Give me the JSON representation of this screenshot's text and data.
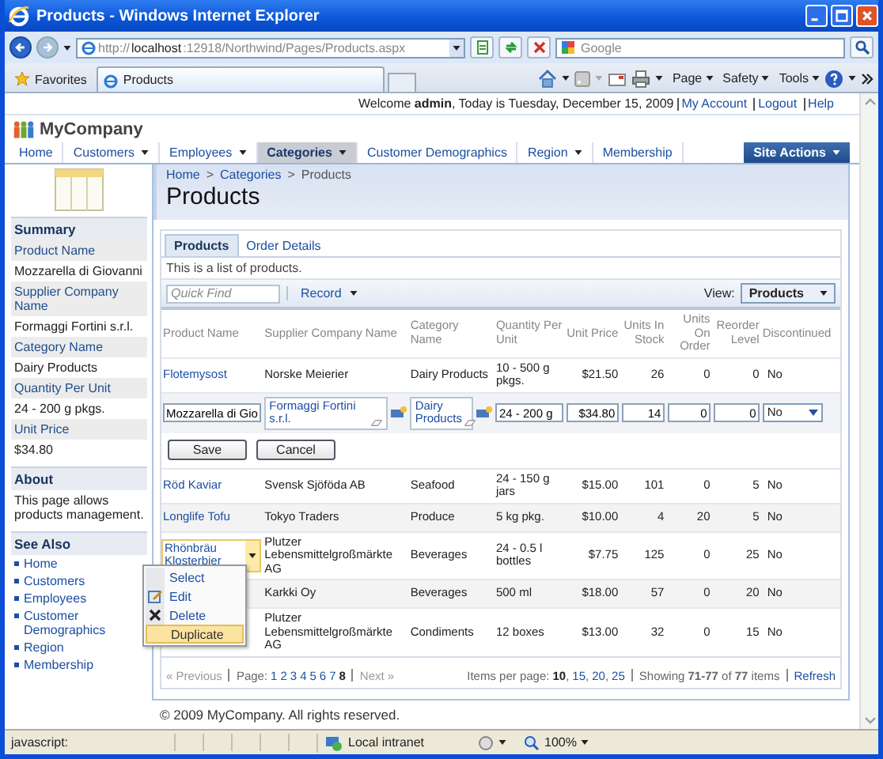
{
  "browser": {
    "title": "Products - Windows Internet Explorer",
    "address": {
      "scheme": "http://",
      "host": "localhost",
      "rest": ":12918/Northwind/Pages/Products.aspx"
    },
    "search_placeholder": "Google",
    "favorites": "Favorites",
    "tab": "Products",
    "commands": [
      "Page",
      "Safety",
      "Tools"
    ],
    "status": {
      "text": "javascript:",
      "zone": "Local intranet",
      "zoom": "100%"
    }
  },
  "header": {
    "welcome": "Welcome **admin**, Today is Tuesday, December 15, 2009",
    "links": [
      "My Account",
      "Logout",
      "Help"
    ],
    "brand": "MyCompany",
    "menu": [
      {
        "label": "Home",
        "dropdown": false,
        "selected": false
      },
      {
        "label": "Customers",
        "dropdown": true,
        "selected": false
      },
      {
        "label": "Employees",
        "dropdown": true,
        "selected": false
      },
      {
        "label": "Categories",
        "dropdown": true,
        "selected": true
      },
      {
        "label": "Customer Demographics",
        "dropdown": false,
        "selected": false
      },
      {
        "label": "Region",
        "dropdown": true,
        "selected": false
      },
      {
        "label": "Membership",
        "dropdown": false,
        "selected": false
      }
    ],
    "site_actions": "Site Actions"
  },
  "sidebar": {
    "summary_title": "Summary",
    "fields": [
      {
        "label": "Product Name",
        "value": "Mozzarella di Giovanni"
      },
      {
        "label": "Supplier Company Name",
        "value": "Formaggi Fortini s.r.l."
      },
      {
        "label": "Category Name",
        "value": "Dairy Products"
      },
      {
        "label": "Quantity Per Unit",
        "value": "24 - 200 g pkgs."
      },
      {
        "label": "Unit Price",
        "value": "$34.80"
      }
    ],
    "about_title": "About",
    "about_text": "This page allows products management.",
    "see_also_title": "See Also",
    "see_also": [
      "Home",
      "Customers",
      "Employees",
      "Customer Demographics",
      "Region",
      "Membership"
    ]
  },
  "main": {
    "breadcrumb": [
      "Home",
      "Categories",
      "Products"
    ],
    "separator": ">",
    "title": "Products",
    "tabs": [
      {
        "label": "Products",
        "selected": true
      },
      {
        "label": "Order Details",
        "selected": false
      }
    ],
    "description": "This is a list of products.",
    "quick_find_placeholder": "Quick Find",
    "record_menu": "Record",
    "view_label": "View:",
    "view": "Products",
    "columns": [
      "Product Name",
      "Supplier Company Name",
      "Category Name",
      "Quantity Per Unit",
      "Unit Price",
      "Units In Stock",
      "Units On Order",
      "Reorder Level",
      "Discontinued"
    ],
    "rows": [
      {
        "kind": "data",
        "selected": false,
        "name": "Flotemysost",
        "supplier": "Norske Meierier",
        "category": "Dairy Products",
        "quantity": "10 - 500 g pkgs.",
        "price": "$21.50",
        "stock": "26",
        "on_order": "0",
        "reorder": "0",
        "discontinued": "No"
      },
      {
        "kind": "edit",
        "name": "Mozzarella di Gio",
        "supplier": "Formaggi Fortini s.r.l.",
        "category": "Dairy Products",
        "quantity": "24 - 200 g",
        "price": "$34.80",
        "stock": "14",
        "on_order": "0",
        "reorder": "0",
        "discontinued": "No",
        "save": "Save",
        "cancel": "Cancel"
      },
      {
        "kind": "data",
        "selected": false,
        "name": "Röd Kaviar",
        "supplier": "Svensk Sjöföda AB",
        "category": "Seafood",
        "quantity": "24 - 150 g jars",
        "price": "$15.00",
        "stock": "101",
        "on_order": "0",
        "reorder": "5",
        "discontinued": "No"
      },
      {
        "kind": "data",
        "selected": false,
        "name": "Longlife Tofu",
        "supplier": "Tokyo Traders",
        "category": "Produce",
        "quantity": "5 kg pkg.",
        "price": "$10.00",
        "stock": "4",
        "on_order": "20",
        "reorder": "5",
        "discontinued": "No"
      },
      {
        "kind": "data",
        "selected": true,
        "name": "Rhönbräu Klosterbier",
        "supplier": "Plutzer Lebensmittelgroßmärkte AG",
        "category": "Beverages",
        "quantity": "24 - 0.5 l bottles",
        "price": "$7.75",
        "stock": "125",
        "on_order": "0",
        "reorder": "25",
        "discontinued": "No"
      },
      {
        "kind": "data",
        "selected": false,
        "supplier": "Karkki Oy",
        "category": "Beverages",
        "quantity": "500 ml",
        "price": "$18.00",
        "stock": "57",
        "on_order": "0",
        "reorder": "20",
        "discontinued": "No"
      },
      {
        "kind": "data",
        "selected": false,
        "supplier": "Plutzer Lebensmittelgroßmärkte AG",
        "category": "Condiments",
        "quantity": "12 boxes",
        "price": "$13.00",
        "stock": "32",
        "on_order": "0",
        "reorder": "15",
        "discontinued": "No"
      }
    ],
    "context_menu": [
      {
        "label": "Select",
        "kind": "plain",
        "selected": false
      },
      {
        "label": "Edit",
        "kind": "edit",
        "selected": false
      },
      {
        "label": "Delete",
        "kind": "delete",
        "selected": false
      },
      {
        "label": "Duplicate",
        "kind": "plain",
        "selected": true
      }
    ],
    "pager": {
      "previous": "« Previous",
      "page_label": "Page:",
      "pages": [
        {
          "label": "1",
          "selected": false
        },
        {
          "label": "2",
          "selected": false
        },
        {
          "label": "3",
          "selected": false
        },
        {
          "label": "4",
          "selected": false
        },
        {
          "label": "5",
          "selected": false
        },
        {
          "label": "6",
          "selected": false
        },
        {
          "label": "7",
          "selected": false
        },
        {
          "label": "8",
          "selected": true
        }
      ],
      "next": "Next »",
      "per_page_label": "Items per page:",
      "per_page": [
        {
          "label": "10",
          "selected": true
        },
        {
          "label": "15",
          "selected": false
        },
        {
          "label": "20",
          "selected": false
        },
        {
          "label": "25",
          "selected": false
        }
      ],
      "per_page_separator": ",",
      "showing": "Showing **71-77** of **77** items",
      "refresh": "Refresh"
    }
  },
  "footer": "© 2009 MyCompany. All rights reserved."
}
